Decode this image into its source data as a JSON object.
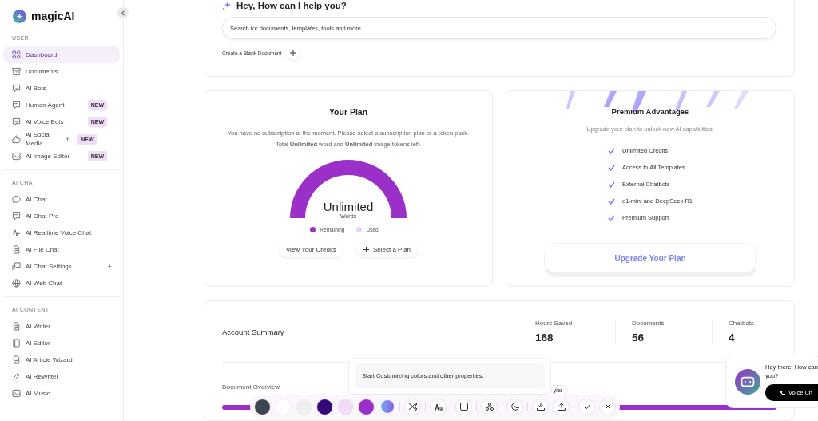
{
  "brand": {
    "name": "magicAI"
  },
  "sidebar": {
    "sections": [
      {
        "label": "USER",
        "items": [
          {
            "label": "Dashboard",
            "kind": "grid",
            "selected": true
          },
          {
            "label": "Documents",
            "kind": "archive",
            "selected": false
          },
          {
            "label": "AI Bots",
            "kind": "bot",
            "selected": false
          },
          {
            "label": "Human Agent",
            "kind": "message",
            "selected": false,
            "badge": "NEW"
          },
          {
            "label": "AI Voice Bots",
            "kind": "bot",
            "selected": false,
            "badge": "NEW"
          },
          {
            "label": "AI Social Media",
            "kind": "thumb",
            "selected": false,
            "badge": "NEW",
            "expand": "+"
          },
          {
            "label": "AI Image Editor",
            "kind": "image",
            "selected": false,
            "badge": "NEW"
          }
        ]
      },
      {
        "label": "AI CHAT",
        "items": [
          {
            "label": "AI Chat",
            "kind": "chat",
            "selected": false
          },
          {
            "label": "AI Chat Pro",
            "kind": "message",
            "selected": false
          },
          {
            "label": "AI Realtime Voice Chat",
            "kind": "wave",
            "selected": false
          },
          {
            "label": "AI File Chat",
            "kind": "file",
            "selected": false
          },
          {
            "label": "AI Chat Settings",
            "kind": "settings",
            "selected": false,
            "expand": "+"
          },
          {
            "label": "AI Web Chat",
            "kind": "globe",
            "selected": false
          }
        ]
      },
      {
        "label": "AI CONTENT",
        "items": [
          {
            "label": "AI Writer",
            "kind": "file",
            "selected": false
          },
          {
            "label": "AI Editor",
            "kind": "book",
            "selected": false
          },
          {
            "label": "AI Article Wizard",
            "kind": "file",
            "selected": false
          },
          {
            "label": "AI ReWriter",
            "kind": "pen",
            "selected": false
          },
          {
            "label": "AI Music",
            "kind": "image",
            "selected": false
          }
        ]
      }
    ]
  },
  "hero": {
    "title": "Hey, How can I help you?",
    "search": {
      "placeholder": "Search for documents, templates, tools and more"
    },
    "create_label": "Create a Blank Document"
  },
  "plan": {
    "title": "Your Plan",
    "text": "You have no subscription at the moment. Please select a subscription plan or a token pack. Total **Unlimited** word and **Unlimited** image tokens left.",
    "gauge_value": "Unlimited",
    "gauge_unit": "Words",
    "legend": [
      {
        "label": "Remaining",
        "color": "#9b30c9"
      },
      {
        "label": "Used",
        "color": "#ead3f5"
      }
    ],
    "buttons": [
      "View Your Credits",
      "Select a Plan"
    ]
  },
  "premium": {
    "title": "Premium Advantages",
    "subtitle": "Upgrade your plan to unlock new AI capabilities.",
    "features": [
      "Unlimited Credits",
      "Access to All Templates",
      "External Chatbots",
      "o1-mini and DeepSeek R1",
      "Premium Support"
    ],
    "button": "Upgrade Your Plan"
  },
  "summary": {
    "title": "Account Summary",
    "stats": [
      {
        "label": "Hours Saved",
        "value": "168"
      },
      {
        "label": "Documents",
        "value": "56"
      },
      {
        "label": "Chatbots",
        "value": "4"
      }
    ],
    "overview_title": "Document Overview",
    "styles_tag": "yles"
  },
  "customizer": {
    "message": "Start Customizing colors and other properties.",
    "swatches": [
      {
        "color": "#3f4451"
      },
      {
        "color": "#ffffff"
      },
      {
        "color": "#efefef"
      },
      {
        "color": "#36087a"
      },
      {
        "color": "#f1dcf8"
      },
      {
        "color": "#9a30c9"
      }
    ],
    "tools": [
      {
        "kind": "gradient"
      },
      {
        "kind": "shuffle"
      },
      {
        "kind": "font"
      },
      {
        "kind": "panel"
      },
      {
        "kind": "nodes"
      },
      {
        "kind": "moon"
      },
      {
        "kind": "download"
      },
      {
        "kind": "upload"
      },
      {
        "kind": "check"
      },
      {
        "kind": "close"
      }
    ]
  },
  "chat_widget": {
    "message": "Hey there, How can you?",
    "button": "Voice Ch"
  }
}
